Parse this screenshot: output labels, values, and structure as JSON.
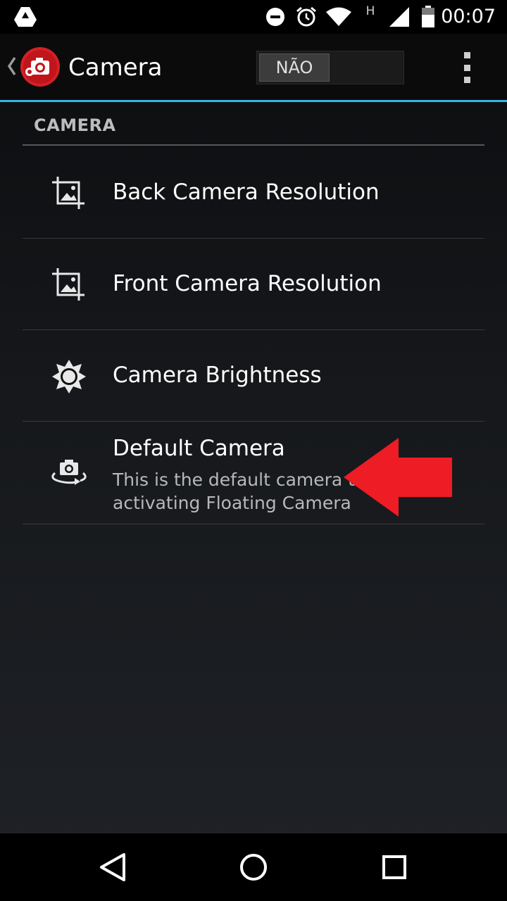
{
  "status_bar": {
    "time": "00:07",
    "icons": [
      "drive-icon",
      "do-not-disturb-icon",
      "alarm-icon",
      "wifi-icon",
      "network-h-icon",
      "signal-icon",
      "battery-icon"
    ],
    "network_label": "H"
  },
  "action_bar": {
    "title": "Camera",
    "toggle_label": "NÃO",
    "accent_color": "#33b5e5"
  },
  "category": {
    "title": "CAMERA"
  },
  "preferences": [
    {
      "title": "Back Camera Resolution",
      "icon": "crop-icon"
    },
    {
      "title": "Front Camera Resolution",
      "icon": "crop-icon"
    },
    {
      "title": "Camera Brightness",
      "icon": "brightness-icon"
    },
    {
      "title": "Default Camera",
      "summary_line1": "This is the default camera t",
      "summary_line2": "activating Floating Camera",
      "icon": "switch-camera-icon"
    }
  ],
  "annotation": {
    "arrow_color": "#ee1c24",
    "icon": "red-arrow-icon"
  },
  "nav_bar": {
    "icons": [
      "back-icon",
      "home-icon",
      "recents-icon"
    ]
  }
}
